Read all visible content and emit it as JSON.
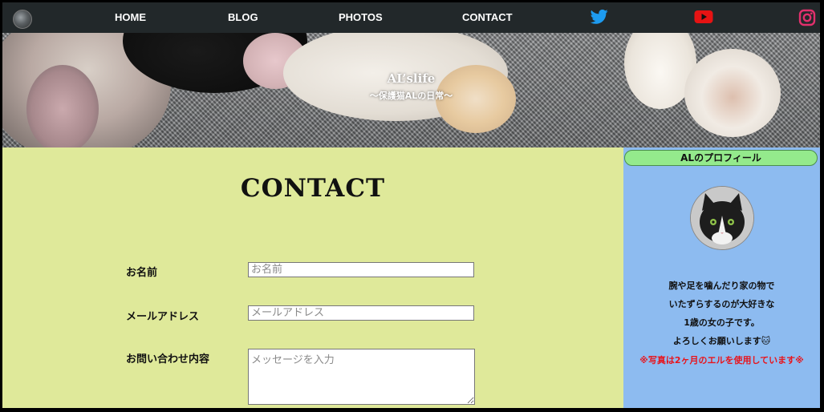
{
  "nav": {
    "items": [
      "HOME",
      "BLOG",
      "PHOTOS",
      "CONTACT"
    ],
    "icons": [
      "site-logo-icon",
      "twitter-icon",
      "youtube-icon",
      "instagram-icon"
    ],
    "colors": {
      "bar": "#22282a",
      "twitter": "#1d9bf0",
      "youtube": "#e61313",
      "instagram": "#e1306c"
    }
  },
  "hero": {
    "title": "AL’slife",
    "subtitle": "～保護猫ALの日常～"
  },
  "contact": {
    "heading": "CONTACT",
    "fields": [
      {
        "label": "お名前",
        "placeholder": "お名前",
        "value": ""
      },
      {
        "label": "メールアドレス",
        "placeholder": "メールアドレス",
        "value": ""
      },
      {
        "label": "お問い合わせ内容",
        "placeholder": "メッセージを入力",
        "value": ""
      }
    ],
    "background": "#dfe99a"
  },
  "sidebar": {
    "title": "ALのプロフィール",
    "lines": [
      "腕や足を噛んだり家の物で",
      "いたずらするのが大好きな",
      "1歳の女の子です。",
      "よろしくお願いします"
    ],
    "emoji_icon": "cat-face-icon",
    "note": "※写真は2ヶ月のエルを使用しています※",
    "colors": {
      "background": "#8dbbf0",
      "title": "#94ea8c",
      "note": "#e8141c"
    }
  }
}
